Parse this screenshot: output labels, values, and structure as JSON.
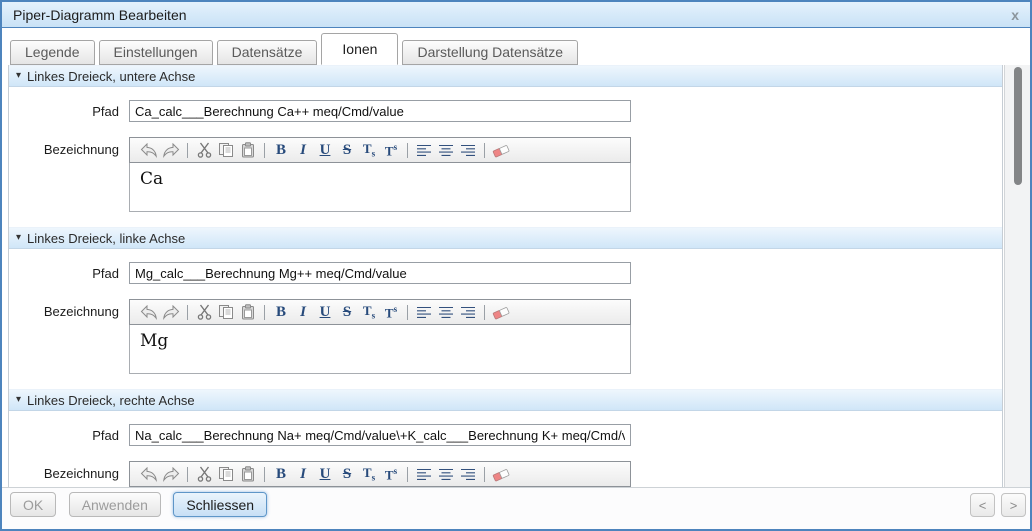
{
  "window": {
    "title": "Piper-Diagramm Bearbeiten",
    "close_label": "x"
  },
  "tabs": [
    {
      "label": "Legende",
      "active": false
    },
    {
      "label": "Einstellungen",
      "active": false
    },
    {
      "label": "Datensätze",
      "active": false
    },
    {
      "label": "Ionen",
      "active": true
    },
    {
      "label": "Darstellung Datensätze",
      "active": false
    }
  ],
  "sections": [
    {
      "title": "Linkes Dreieck, untere Achse",
      "pfad_label": "Pfad",
      "pfad_value": "Ca_calc___Berechnung Ca++ meq/Cmd/value",
      "bezeichnung_label": "Bezeichnung",
      "bezeichnung_value": "Ca"
    },
    {
      "title": "Linkes Dreieck, linke Achse",
      "pfad_label": "Pfad",
      "pfad_value": "Mg_calc___Berechnung Mg++ meq/Cmd/value",
      "bezeichnung_label": "Bezeichnung",
      "bezeichnung_value": "Mg"
    },
    {
      "title": "Linkes Dreieck, rechte Achse",
      "pfad_label": "Pfad",
      "pfad_value": "Na_calc___Berechnung Na+ meq/Cmd/value\\+K_calc___Berechnung K+ meq/Cmd/va",
      "bezeichnung_label": "Bezeichnung",
      "bezeichnung_value": ""
    }
  ],
  "editor_toolbar": {
    "icons": [
      "undo",
      "redo",
      "cut",
      "copy",
      "paste",
      "bold",
      "italic",
      "underline",
      "strikethrough",
      "subscript",
      "superscript",
      "align-left",
      "align-center",
      "align-right",
      "remove-format"
    ],
    "bold_label": "B",
    "italic_label": "I",
    "underline_label": "U",
    "strike_label": "S",
    "sub_main": "T",
    "sub_small": "s",
    "sup_main": "T",
    "sup_small": "s"
  },
  "footer": {
    "ok_label": "OK",
    "apply_label": "Anwenden",
    "close_label": "Schliessen",
    "prev_label": "<",
    "next_label": ">"
  },
  "colors": {
    "dialog_border": "#4d84bd",
    "titlebar_bg": "#d5e8f9",
    "section_header_bg": "#d9ebf9",
    "primary_button_border": "#5e96c8",
    "toolbar_icon_blue": "#274a7b",
    "eraser_pink": "#ee8585"
  },
  "collapse_arrow": "▾"
}
